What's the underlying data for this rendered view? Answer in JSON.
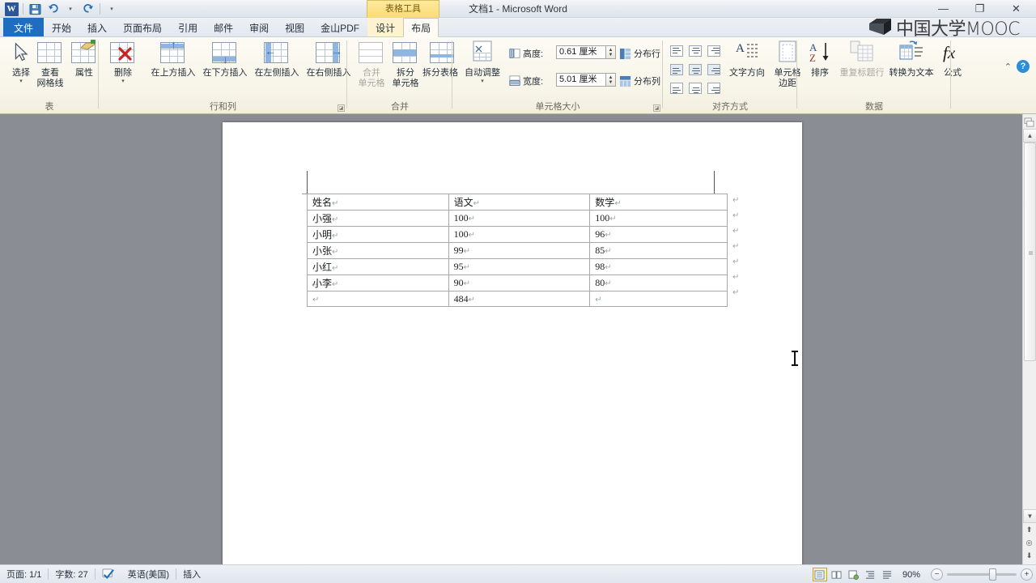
{
  "window": {
    "title": "文档1 - Microsoft Word",
    "contextual_tools": "表格工具",
    "minimize": "—",
    "restore": "❐",
    "close": "✕"
  },
  "quick_access": {
    "app_logo": "W",
    "save": "save-icon",
    "undo": "undo-icon",
    "redo": "redo-icon",
    "customize": "▾"
  },
  "tabs": [
    {
      "label": "文件",
      "kind": "file"
    },
    {
      "label": "开始",
      "kind": "normal"
    },
    {
      "label": "插入",
      "kind": "normal"
    },
    {
      "label": "页面布局",
      "kind": "normal"
    },
    {
      "label": "引用",
      "kind": "normal"
    },
    {
      "label": "邮件",
      "kind": "normal"
    },
    {
      "label": "审阅",
      "kind": "normal"
    },
    {
      "label": "视图",
      "kind": "normal"
    },
    {
      "label": "金山PDF",
      "kind": "normal"
    },
    {
      "label": "设计",
      "kind": "ctx"
    },
    {
      "label": "布局",
      "kind": "active"
    }
  ],
  "ribbon": {
    "groups": [
      {
        "name": "表"
      },
      {
        "name": "行和列"
      },
      {
        "name": "合并"
      },
      {
        "name": "单元格大小"
      },
      {
        "name": "对齐方式"
      },
      {
        "name": "数据"
      }
    ],
    "table_group": {
      "select": "选择",
      "view_gridlines": "查看\n网格线",
      "view_gridlines_l1": "查看",
      "view_gridlines_l2": "网格线",
      "properties": "属性"
    },
    "rows_cols": {
      "delete": "删除",
      "insert_above": "在上方插入",
      "insert_below": "在下方插入",
      "insert_left": "在左侧插入",
      "insert_right": "在右侧插入"
    },
    "merge": {
      "merge_cells_l1": "合并",
      "merge_cells_l2": "单元格",
      "split_cells_l1": "拆分",
      "split_cells_l2": "单元格",
      "split_table": "拆分表格"
    },
    "cell_size": {
      "autofit": "自动调整",
      "height_label": "高度:",
      "height_value": "0.61 厘米",
      "width_label": "宽度:",
      "width_value": "5.01 厘米",
      "distribute_rows": "分布行",
      "distribute_cols": "分布列"
    },
    "alignment": {
      "text_direction": "文字方向",
      "cell_margins_l1": "单元格",
      "cell_margins_l2": "边距"
    },
    "data": {
      "sort": "排序",
      "repeat_header": "重复标题行",
      "convert_to_text": "转换为文本",
      "formula": "公式"
    },
    "minimize_ribbon": "⌃",
    "help": "?"
  },
  "document": {
    "table": {
      "headers": [
        "姓名",
        "语文",
        "数学"
      ],
      "rows": [
        [
          "小强",
          "100",
          "100"
        ],
        [
          "小明",
          "100",
          "96"
        ],
        [
          "小张",
          "99",
          "85"
        ],
        [
          "小红",
          "95",
          "98"
        ],
        [
          "小李",
          "90",
          "80"
        ],
        [
          "",
          "484",
          ""
        ]
      ],
      "paragraph_mark": "↵"
    },
    "trailing_paragraph_mark": "↵"
  },
  "watermark": {
    "text": "中国大学MOOC"
  },
  "status_bar": {
    "page": "页面: 1/1",
    "words": "字数: 27",
    "proofing_icon": "proofing-check-icon",
    "language": "英语(美国)",
    "insert_mode": "插入",
    "zoom_percent": "90%",
    "zoom_out": "−",
    "zoom_in": "+",
    "views": [
      "print-layout-view",
      "full-screen-reading-view",
      "web-layout-view",
      "outline-view",
      "draft-view"
    ]
  },
  "scrollbar": {
    "up": "▲",
    "down": "▼",
    "prev_page": "⬆",
    "browse_object": "◎",
    "next_page": "⬇",
    "split_handle": "split-handle"
  }
}
